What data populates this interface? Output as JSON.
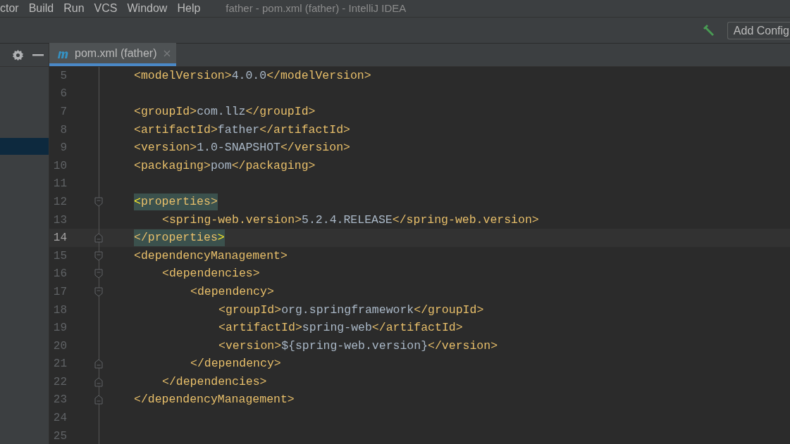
{
  "menu_bar": {
    "items": [
      "ctor",
      "Build",
      "Run",
      "VCS",
      "Window",
      "Help"
    ],
    "window_title": "father - pom.xml (father) - IntelliJ IDEA"
  },
  "toolbar": {
    "run_config_button": "Add Config"
  },
  "editor_tabs": [
    {
      "label": "pom.xml (father)",
      "selected": true
    }
  ],
  "project_panel": {
    "rows": [
      {
        "selected": true
      }
    ]
  },
  "editor": {
    "lines": [
      {
        "number": "5",
        "kind": "plain",
        "current": false,
        "tokens": [
          {
            "kind": "tag",
            "text": "<modelVersion>"
          },
          {
            "kind": "value",
            "text": "4.0.0"
          },
          {
            "kind": "tag",
            "text": "</modelVersion>"
          }
        ]
      },
      {
        "number": "6",
        "kind": "plain",
        "current": false
      },
      {
        "number": "7",
        "kind": "plain",
        "current": false,
        "tokens": [
          {
            "kind": "tag",
            "text": "<groupId>"
          },
          {
            "kind": "value",
            "text": "com.llz"
          },
          {
            "kind": "tag",
            "text": "</groupId>"
          }
        ]
      },
      {
        "number": "8",
        "kind": "plain",
        "current": false,
        "tokens": [
          {
            "kind": "tag",
            "text": "<artifactId>"
          },
          {
            "kind": "value",
            "text": "father"
          },
          {
            "kind": "tag",
            "text": "</artifactId>"
          }
        ]
      },
      {
        "number": "9",
        "kind": "plain",
        "current": false,
        "tokens": [
          {
            "kind": "tag",
            "text": "<version>"
          },
          {
            "kind": "value",
            "text": "1.0-SNAPSHOT"
          },
          {
            "kind": "tag",
            "text": "</version>"
          }
        ]
      },
      {
        "number": "10",
        "kind": "plain",
        "current": false,
        "tokens": [
          {
            "kind": "tag",
            "text": "<packaging>"
          },
          {
            "kind": "value",
            "text": "pom"
          },
          {
            "kind": "tag",
            "text": "</packaging>"
          }
        ]
      },
      {
        "number": "11",
        "kind": "plain",
        "current": false
      },
      {
        "number": "12",
        "kind": "fold_start",
        "current": false,
        "tokens": [
          {
            "kind": "match_bracket",
            "text": "<"
          },
          {
            "kind": "match_tag",
            "text": "properties>"
          }
        ],
        "children": [
          {
            "number": "13",
            "kind": "plain",
            "current": false,
            "tokens": [
              {
                "kind": "tag",
                "text": "<spring-web.version>"
              },
              {
                "kind": "value",
                "text": "5.2.4.RELEASE"
              },
              {
                "kind": "tag",
                "text": "</spring-web.version>"
              }
            ]
          }
        ]
      },
      {
        "number": "14",
        "kind": "fold_end",
        "current": true,
        "tokens": [
          {
            "kind": "match_tag",
            "text": "</properties"
          },
          {
            "kind": "match_bracket",
            "text": ">"
          }
        ]
      },
      {
        "number": "15",
        "kind": "fold_start",
        "current": false,
        "tokens": [
          {
            "kind": "tag",
            "text": "<dependencyManagement>"
          }
        ],
        "children": [
          {
            "number": "16",
            "kind": "fold_start",
            "current": false,
            "tokens": [
              {
                "kind": "tag",
                "text": "<dependencies>"
              }
            ],
            "children": [
              {
                "number": "17",
                "kind": "fold_start",
                "current": false,
                "tokens": [
                  {
                    "kind": "tag",
                    "text": "<dependency>"
                  }
                ],
                "children": [
                  {
                    "number": "18",
                    "kind": "plain",
                    "current": false,
                    "tokens": [
                      {
                        "kind": "tag",
                        "text": "<groupId>"
                      },
                      {
                        "kind": "value",
                        "text": "org.springframework"
                      },
                      {
                        "kind": "tag",
                        "text": "</groupId>"
                      }
                    ]
                  },
                  {
                    "number": "19",
                    "kind": "plain",
                    "current": false,
                    "tokens": [
                      {
                        "kind": "tag",
                        "text": "<artifactId>"
                      },
                      {
                        "kind": "value",
                        "text": "spring-web"
                      },
                      {
                        "kind": "tag",
                        "text": "</artifactId>"
                      }
                    ]
                  },
                  {
                    "number": "20",
                    "kind": "plain",
                    "current": false,
                    "tokens": [
                      {
                        "kind": "tag",
                        "text": "<version>"
                      },
                      {
                        "kind": "value",
                        "text": "${spring-web.version}"
                      },
                      {
                        "kind": "tag",
                        "text": "</version>"
                      }
                    ]
                  }
                ]
              },
              {
                "number": "21",
                "kind": "fold_end",
                "current": false,
                "tokens": [
                  {
                    "kind": "tag",
                    "text": "</dependency>"
                  }
                ]
              }
            ]
          },
          {
            "number": "22",
            "kind": "fold_end",
            "current": false,
            "tokens": [
              {
                "kind": "tag",
                "text": "</dependencies>"
              }
            ]
          }
        ]
      },
      {
        "number": "23",
        "kind": "fold_end",
        "current": false,
        "tokens": [
          {
            "kind": "tag",
            "text": "</dependencyManagement>"
          }
        ]
      },
      {
        "number": "24",
        "kind": "plain",
        "current": false
      },
      {
        "number": "25",
        "kind": "plain",
        "current": false
      }
    ]
  }
}
